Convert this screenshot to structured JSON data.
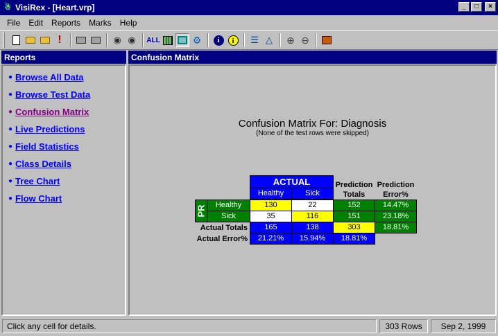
{
  "window": {
    "title": "VisiRex - [Heart.vrp]",
    "icon": "tree-icon"
  },
  "menu": [
    {
      "label": "File"
    },
    {
      "label": "Edit"
    },
    {
      "label": "Reports"
    },
    {
      "label": "Marks"
    },
    {
      "label": "Help"
    }
  ],
  "toolbar": {
    "all_label": "ALL"
  },
  "reports_panel": {
    "title": "Reports",
    "items": [
      {
        "label": "Browse All Data"
      },
      {
        "label": "Browse Test Data"
      },
      {
        "label": "Confusion Matrix"
      },
      {
        "label": "Live Predictions"
      },
      {
        "label": "Field Statistics"
      },
      {
        "label": "Class Details"
      },
      {
        "label": "Tree Chart"
      },
      {
        "label": "Flow Chart"
      }
    ]
  },
  "content_panel": {
    "title": "Confusion Matrix",
    "heading": "Confusion Matrix For: Diagnosis",
    "subheading": "(None of the test rows were skipped)"
  },
  "matrix": {
    "actual_label": "ACTUAL",
    "predicted_label": "PR",
    "classes": [
      "Healthy",
      "Sick"
    ],
    "pred_totals_header_1": "Prediction",
    "pred_totals_header_2": "Totals",
    "pred_error_header_1": "Prediction",
    "pred_error_header_2": "Error%",
    "rows": [
      {
        "label": "Healthy",
        "values": [
          "130",
          "22"
        ],
        "total": "152",
        "error": "14.47%"
      },
      {
        "label": "Sick",
        "values": [
          "35",
          "116"
        ],
        "total": "151",
        "error": "23.18%"
      }
    ],
    "actual_totals_label": "Actual Totals",
    "actual_totals": [
      "165",
      "138"
    ],
    "grand_total": "303",
    "overall_error": "18.81%",
    "actual_error_label": "Actual Error%",
    "actual_errors": [
      "21.21%",
      "15.94%"
    ],
    "overall_error_2": "18.81%"
  },
  "status": {
    "message": "Click any cell for details.",
    "rows": "303 Rows",
    "date": "Sep 2, 1999"
  }
}
